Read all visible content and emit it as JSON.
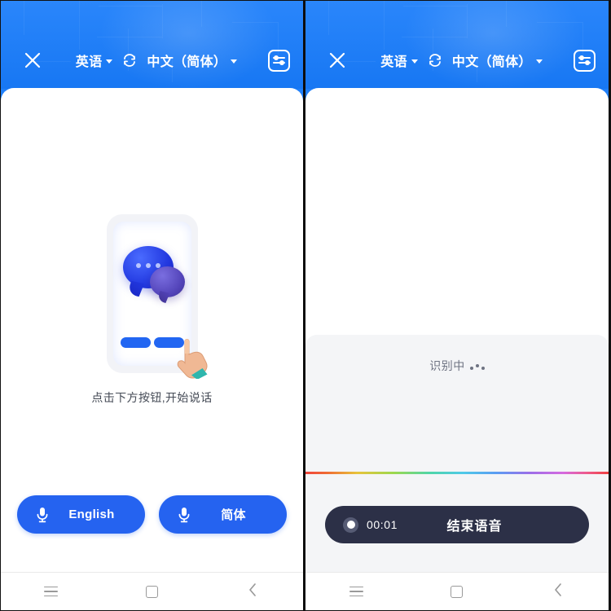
{
  "app": {
    "header": {
      "close_icon": "close-icon",
      "source_language": "英语",
      "swap_icon": "swap-languages-icon",
      "target_language": "中文（简体）",
      "settings_icon": "settings-sliders-icon"
    },
    "nav": {
      "recents_icon": "menu-icon",
      "home_icon": "home-square-icon",
      "back_icon": "back-chevron-icon"
    }
  },
  "left_screen": {
    "illustration": {
      "name": "phone-chat-illustration",
      "chat_dots": [
        "dot",
        "dot",
        "dot"
      ],
      "hand_icon": "pointing-hand-icon"
    },
    "hint_text": "点击下方按钮,开始说话",
    "buttons": [
      {
        "label": "English",
        "icon": "microphone-icon"
      },
      {
        "label": "简体",
        "icon": "microphone-icon"
      }
    ]
  },
  "right_screen": {
    "recognition": {
      "status_text": "识别中",
      "loading_dots": [
        "dot",
        "dot",
        "dot"
      ]
    },
    "waveform_divider": "rainbow-gradient-line",
    "record_bar": {
      "record_icon": "record-dot-icon",
      "timer": "00:01",
      "end_label": "结束语音"
    }
  },
  "colors": {
    "header_blue": "#1a7bf5",
    "button_blue": "#2563f0",
    "dark_bar": "#2c3047",
    "panel_gray": "#f4f5f7",
    "hint_gray": "#444a55"
  }
}
